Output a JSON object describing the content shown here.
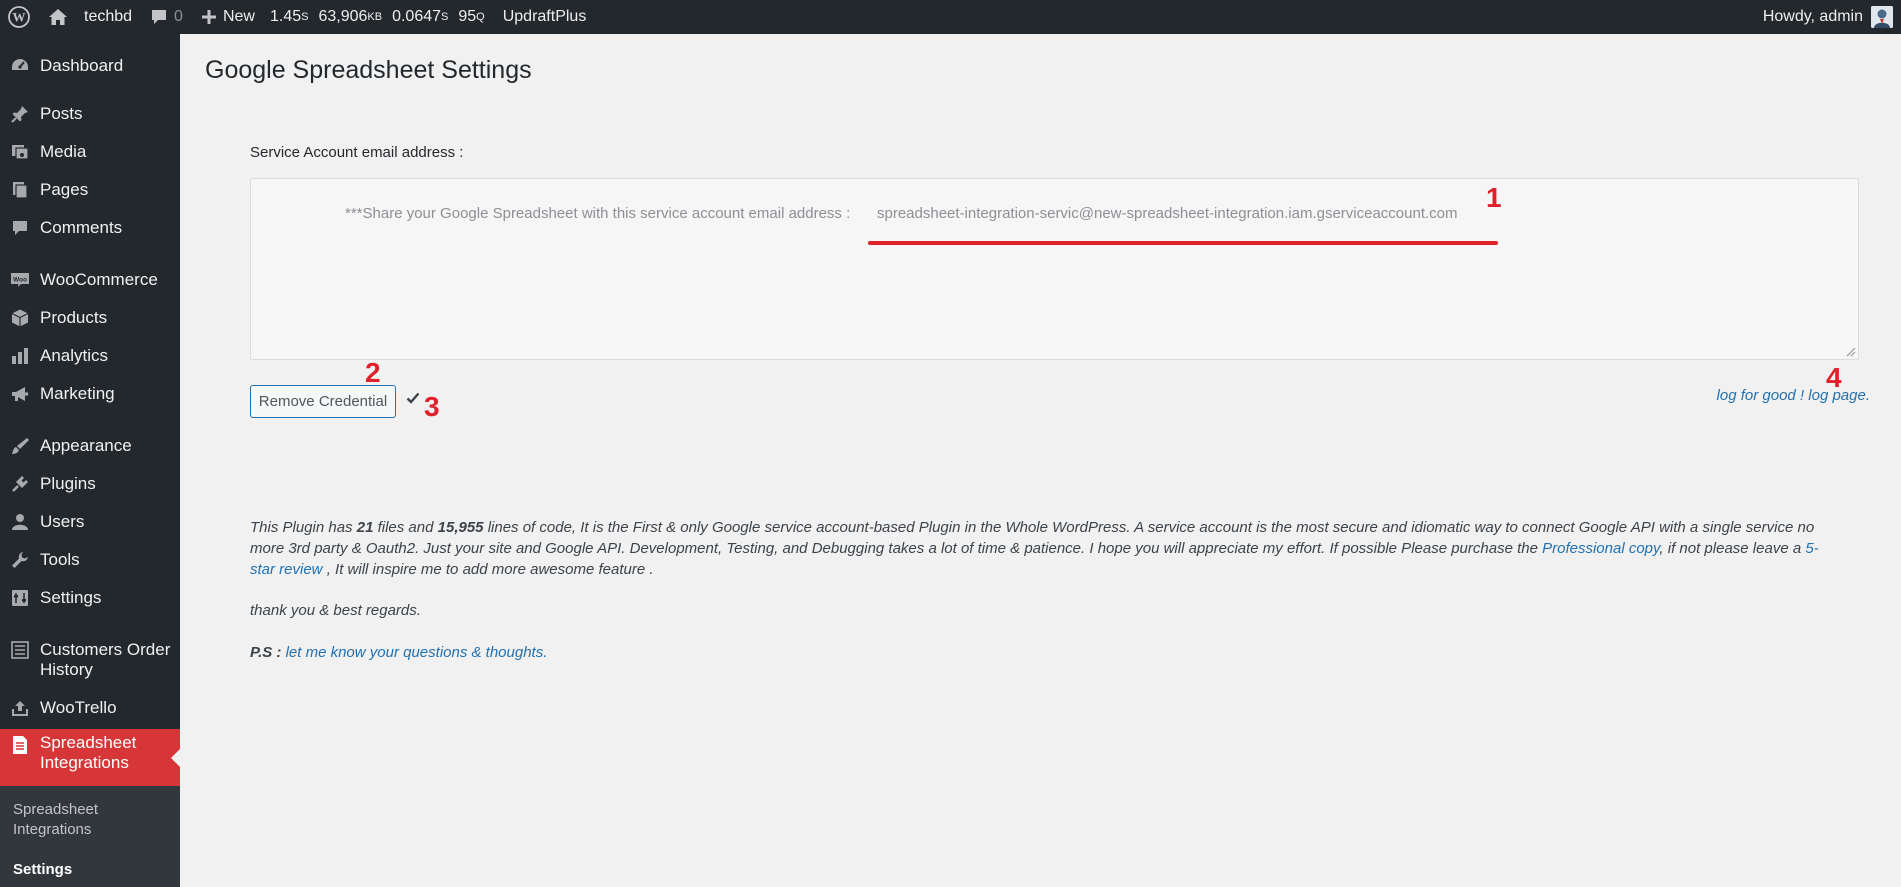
{
  "adminbar": {
    "site_name": "techbd",
    "comments_count": "0",
    "new_label": "New",
    "stats": {
      "load_time": "1.45",
      "load_time_unit": "S",
      "memory": "63,906",
      "memory_unit": "KB",
      "query_time": "0.0647",
      "query_time_unit": "S",
      "queries": "95",
      "queries_unit": "Q"
    },
    "updraft": "UpdraftPlus",
    "howdy": "Howdy, admin"
  },
  "sidebar": {
    "items": [
      {
        "label": "Dashboard",
        "icon": "dashboard-icon"
      },
      {
        "label": "Posts",
        "icon": "pin-icon"
      },
      {
        "label": "Media",
        "icon": "media-icon"
      },
      {
        "label": "Pages",
        "icon": "pages-icon"
      },
      {
        "label": "Comments",
        "icon": "comment-icon"
      },
      {
        "label": "WooCommerce",
        "icon": "woo-icon"
      },
      {
        "label": "Products",
        "icon": "box-icon"
      },
      {
        "label": "Analytics",
        "icon": "bar-chart-icon"
      },
      {
        "label": "Marketing",
        "icon": "megaphone-icon"
      },
      {
        "label": "Appearance",
        "icon": "brush-icon"
      },
      {
        "label": "Plugins",
        "icon": "plug-icon"
      },
      {
        "label": "Users",
        "icon": "user-icon"
      },
      {
        "label": "Tools",
        "icon": "wrench-icon"
      },
      {
        "label": "Settings",
        "icon": "settings-icon"
      },
      {
        "label": "Customers Order History",
        "icon": "list-icon"
      },
      {
        "label": "WooTrello",
        "icon": "upload-icon"
      },
      {
        "label": "Spreadsheet Integrations",
        "icon": "document-icon"
      }
    ],
    "submenu": [
      {
        "label": "Spreadsheet Integrations"
      },
      {
        "label": "Settings"
      }
    ]
  },
  "main": {
    "title": "Google Spreadsheet Settings",
    "email_label": "Service Account email address :",
    "share_text": "***Share your Google Spreadsheet with this service account email address :",
    "service_email": "spreadsheet-integration-servic@new-spreadsheet-integration.iam.gserviceaccount.com",
    "remove_button": "Remove Credential",
    "log_link": "log for good ! log page.",
    "markers": [
      "1",
      "2",
      "3",
      "4"
    ],
    "para1": {
      "t1": "This Plugin has ",
      "files": "21",
      "t2": " files and ",
      "lines": "15,955",
      "t3": " lines of code, It is the First & only Google service account-based Plugin in the Whole WordPress. A service account is the most secure and idiomatic way to connect Google API with a single service no more 3rd party & Oauth2. Just your site and Google API. Development, Testing, and Debugging takes a lot of time & patience. I hope you will appreciate my effort. If possible Please purchase the ",
      "link1": "Professional copy",
      "t4": ", if not please leave a ",
      "link2": "5-star review",
      "t5": " , It will inspire me to add more awesome feature ."
    },
    "thanks": "thank you & best regards.",
    "ps_label": "P.S :",
    "ps_link": "let me know your questions & thoughts."
  },
  "colors": {
    "adminbar_bg": "#23282d",
    "active_menu": "#d63638",
    "link": "#2271b1",
    "annotation_red": "#e0202a"
  }
}
